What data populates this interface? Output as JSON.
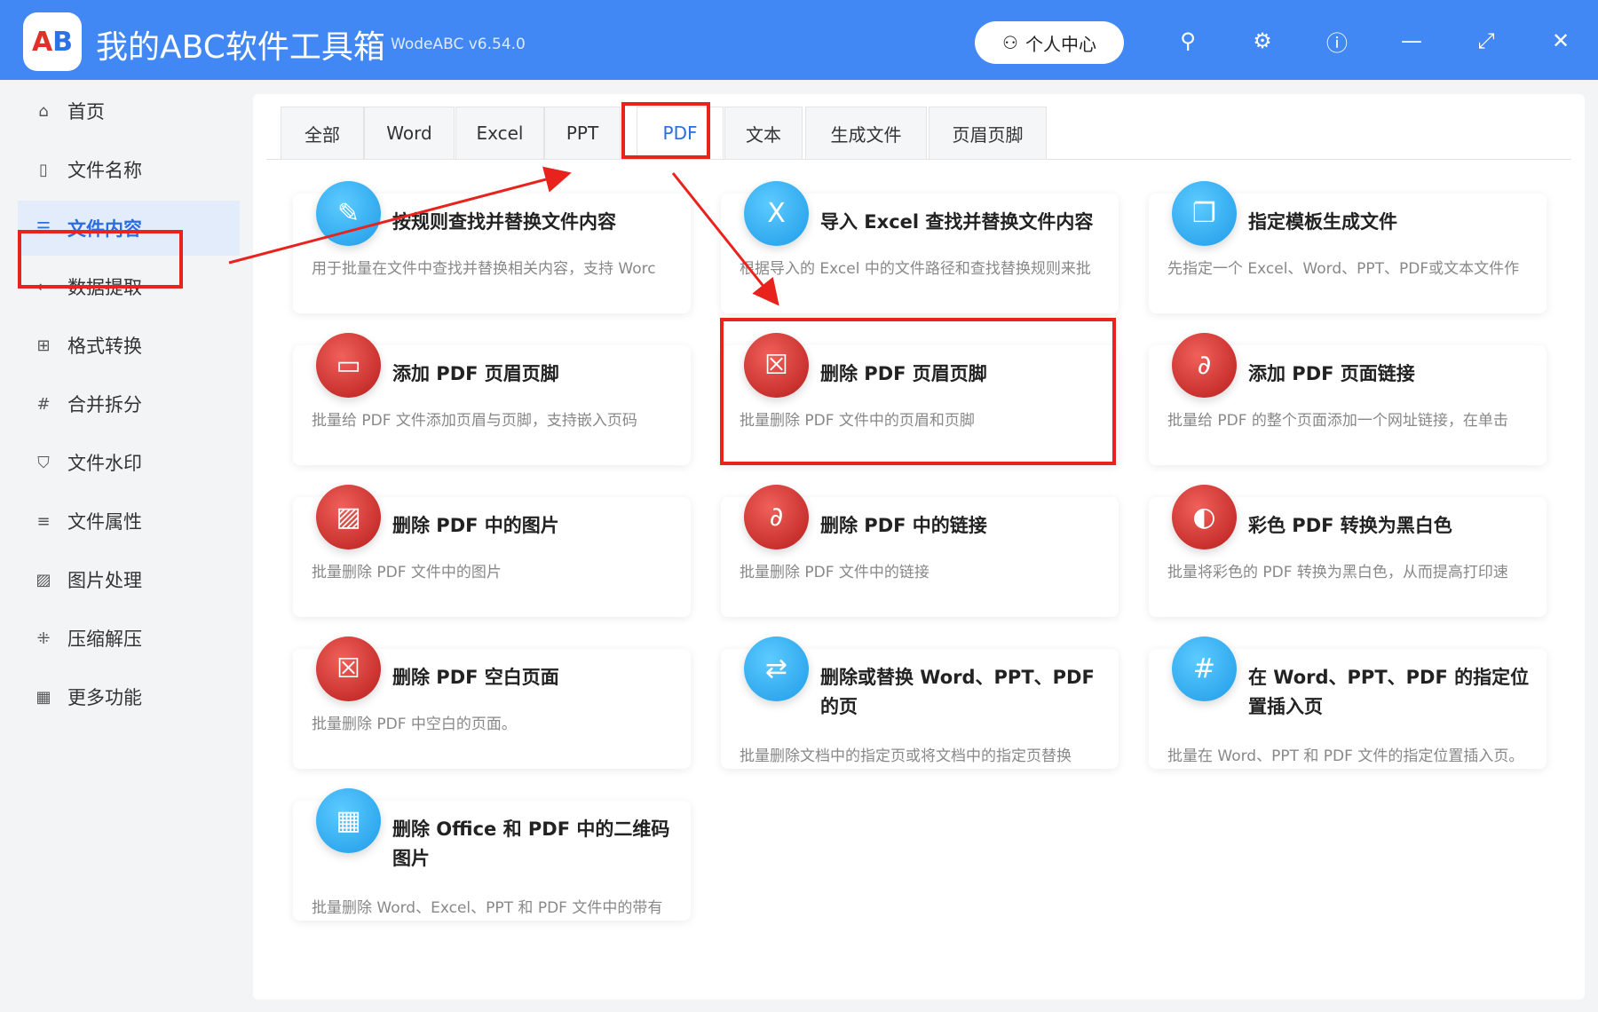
{
  "app": {
    "title": "我的ABC软件工具箱",
    "version": "WodeABC v6.54.0",
    "logo_text": "AB",
    "user_center": "个人中心"
  },
  "sidebar": {
    "items": [
      {
        "label": "首页",
        "icon": "⌂"
      },
      {
        "label": "文件名称",
        "icon": "▯"
      },
      {
        "label": "文件内容",
        "icon": "☰"
      },
      {
        "label": "数据提取",
        "icon": "⇠"
      },
      {
        "label": "格式转换",
        "icon": "⊞"
      },
      {
        "label": "合并拆分",
        "icon": "#"
      },
      {
        "label": "文件水印",
        "icon": "⛉"
      },
      {
        "label": "文件属性",
        "icon": "≡"
      },
      {
        "label": "图片处理",
        "icon": "▨"
      },
      {
        "label": "压缩解压",
        "icon": "⁜"
      },
      {
        "label": "更多功能",
        "icon": "▦"
      }
    ],
    "active": "文件内容"
  },
  "tabs": [
    {
      "label": "全部"
    },
    {
      "label": "Word"
    },
    {
      "label": "Excel"
    },
    {
      "label": "PPT"
    },
    {
      "label": "PDF"
    },
    {
      "label": "文本"
    },
    {
      "label": "生成文件"
    },
    {
      "label": "页眉页脚"
    }
  ],
  "active_tab": "PDF",
  "cards": [
    {
      "title": "按规则查找并替换文件内容",
      "desc": "用于批量在文件中查找并替换相关内容，支持 Worc",
      "color": "blue",
      "glyph": "✎"
    },
    {
      "title": "导入 Excel 查找并替换文件内容",
      "desc": "根据导入的 Excel 中的文件路径和查找替换规则来批",
      "color": "blue",
      "glyph": "X"
    },
    {
      "title": "指定模板生成文件",
      "desc": "先指定一个 Excel、Word、PPT、PDF或文本文件作",
      "color": "blue",
      "glyph": "❐"
    },
    {
      "title": "添加 PDF 页眉页脚",
      "desc": "批量给 PDF 文件添加页眉与页脚，支持嵌入页码",
      "color": "red",
      "glyph": "▭"
    },
    {
      "title": "删除 PDF 页眉页脚",
      "desc": "批量删除 PDF 文件中的页眉和页脚",
      "color": "red",
      "glyph": "☒"
    },
    {
      "title": "添加 PDF 页面链接",
      "desc": "批量给 PDF 的整个页面添加一个网址链接，在单击",
      "color": "red",
      "glyph": "∂"
    },
    {
      "title": "删除 PDF 中的图片",
      "desc": "批量删除 PDF 文件中的图片",
      "color": "red",
      "glyph": "▨"
    },
    {
      "title": "删除 PDF 中的链接",
      "desc": "批量删除 PDF 文件中的链接",
      "color": "red",
      "glyph": "∂"
    },
    {
      "title": "彩色 PDF 转换为黑白色",
      "desc": "批量将彩色的 PDF 转换为黑白色，从而提高打印速",
      "color": "red",
      "glyph": "◐"
    },
    {
      "title": "删除 PDF 空白页面",
      "desc": "批量删除 PDF 中空白的页面。",
      "color": "red",
      "glyph": "☒"
    },
    {
      "title": "删除或替换 Word、PPT、PDF 的页",
      "desc": "批量删除文档中的指定页或将文档中的指定页替换",
      "color": "blue",
      "glyph": "⇄"
    },
    {
      "title": "在 Word、PPT、PDF 的指定位置插入页",
      "desc": "批量在 Word、PPT 和 PDF 文件的指定位置插入页。",
      "color": "blue",
      "glyph": "#"
    },
    {
      "title": "删除 Office 和 PDF 中的二维码图片",
      "desc": "批量删除 Word、Excel、PPT 和 PDF 文件中的带有",
      "color": "blue",
      "glyph": "▦"
    }
  ],
  "colors": {
    "brand": "#4288f5",
    "highlight": "#e8231e"
  }
}
